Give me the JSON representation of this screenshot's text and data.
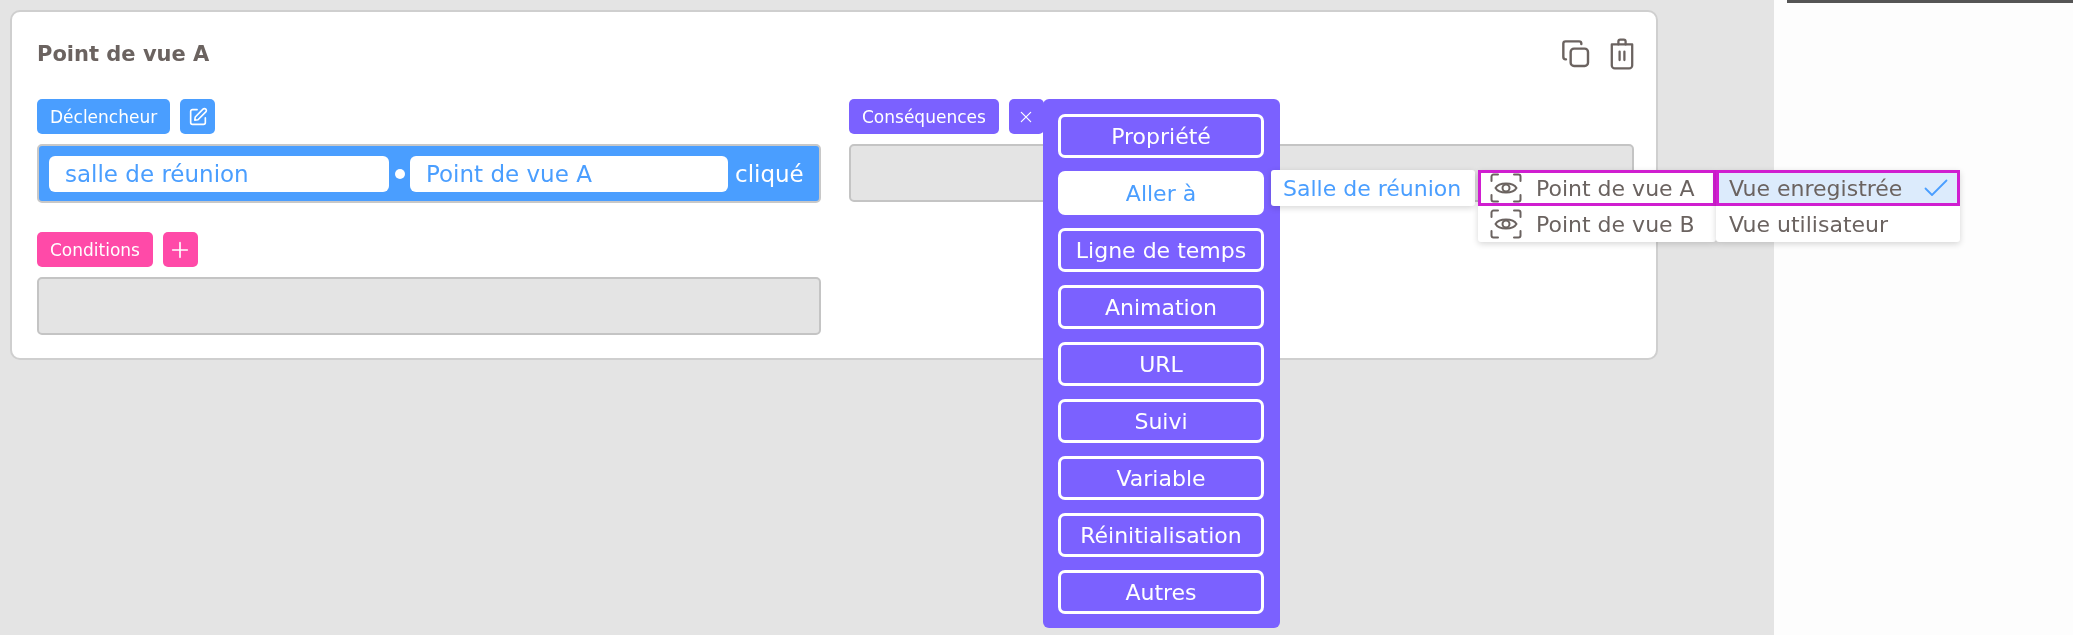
{
  "card": {
    "title": "Point de vue A"
  },
  "trigger": {
    "label": "Déclencheur",
    "scene": "salle de réunion",
    "viewpoint": "Point de vue A",
    "event": "cliqué"
  },
  "conditions": {
    "label": "Conditions"
  },
  "consequences": {
    "label": "Conséquences"
  },
  "action_menu": {
    "items": [
      {
        "label": "Propriété",
        "selected": false
      },
      {
        "label": "Aller à",
        "selected": true
      },
      {
        "label": "Ligne de temps",
        "selected": false
      },
      {
        "label": "Animation",
        "selected": false
      },
      {
        "label": "URL",
        "selected": false
      },
      {
        "label": "Suivi",
        "selected": false
      },
      {
        "label": "Variable",
        "selected": false
      },
      {
        "label": "Réinitialisation",
        "selected": false
      },
      {
        "label": "Autres",
        "selected": false
      }
    ]
  },
  "scene_menu": {
    "items": [
      {
        "label": "Salle de réunion",
        "selected": true
      }
    ]
  },
  "viewpoint_menu": {
    "items": [
      {
        "label": "Point de vue A",
        "selected": true
      },
      {
        "label": "Point de vue B",
        "selected": false
      }
    ]
  },
  "view_menu": {
    "items": [
      {
        "label": "Vue enregistrée",
        "selected": true
      },
      {
        "label": "Vue utilisateur",
        "selected": false
      }
    ]
  }
}
